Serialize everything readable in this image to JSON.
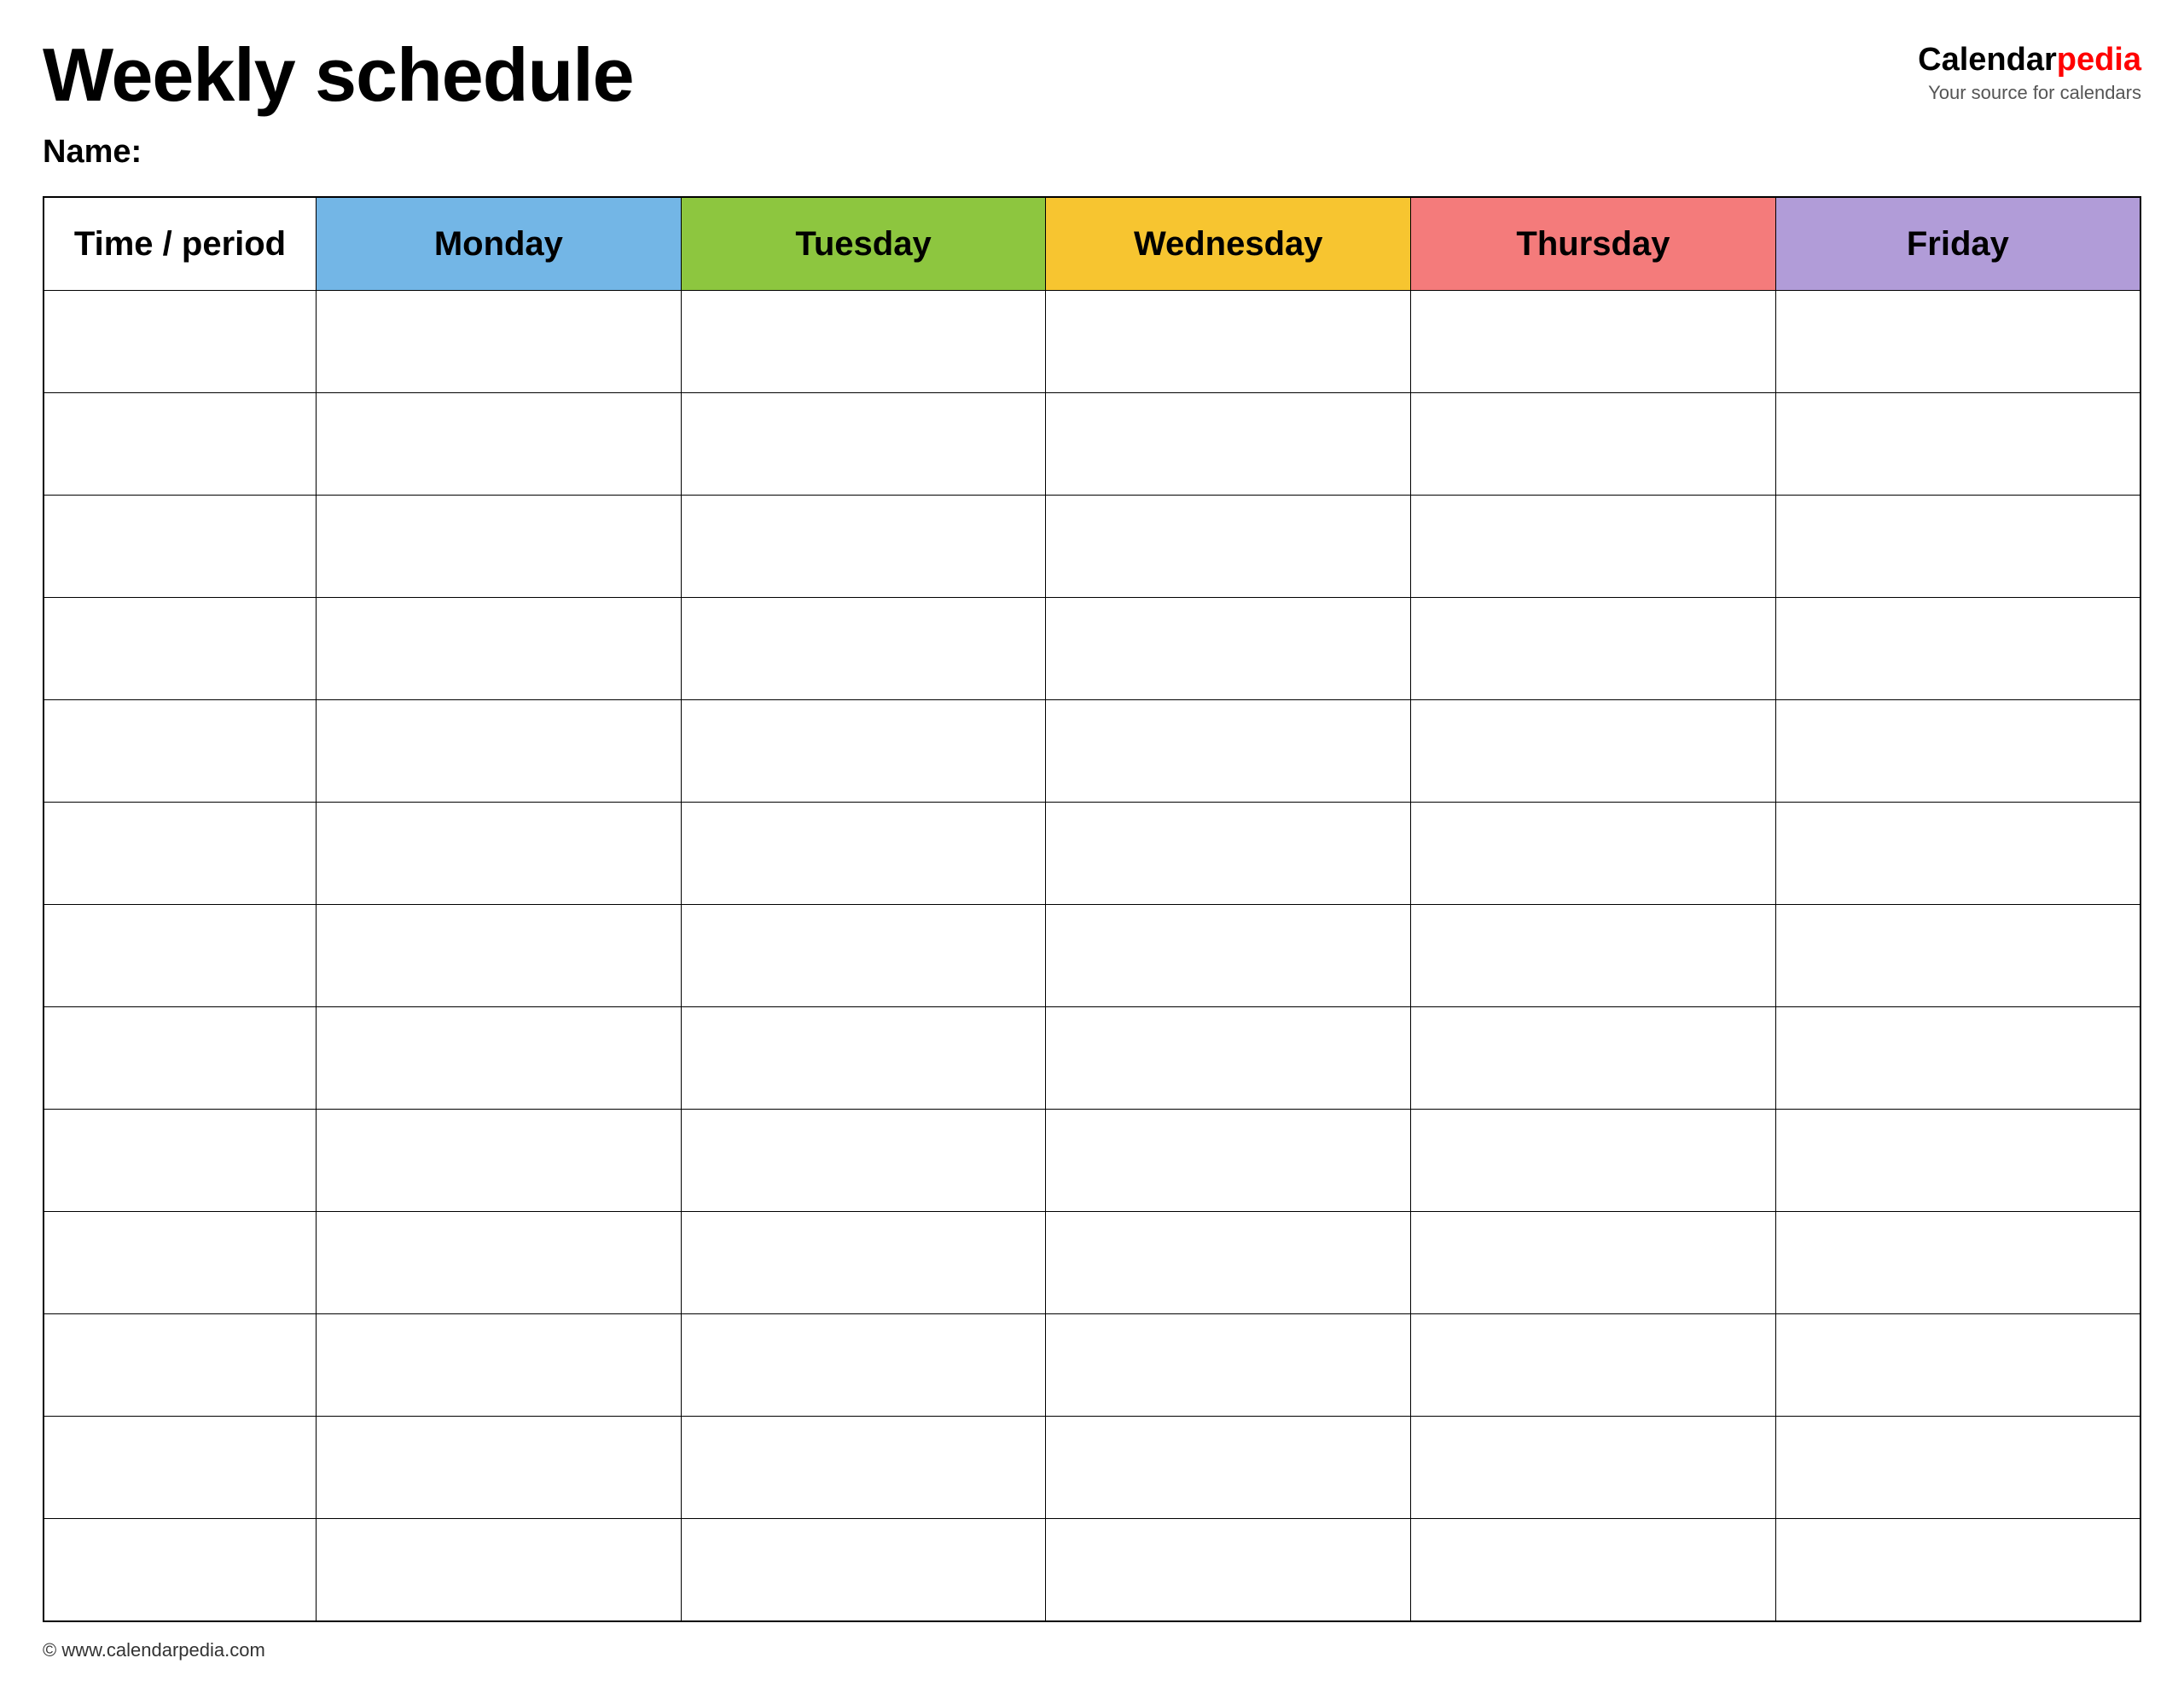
{
  "header": {
    "title": "Weekly schedule",
    "logo_calendar": "Calendar",
    "logo_pedia": "pedia",
    "logo_subtitle": "Your source for calendars",
    "name_label": "Name:"
  },
  "table": {
    "columns": [
      {
        "label": "Time / period",
        "key": "time",
        "color": "#ffffff",
        "text_color": "#000000"
      },
      {
        "label": "Monday",
        "key": "monday",
        "color": "#73b6e6",
        "text_color": "#000000"
      },
      {
        "label": "Tuesday",
        "key": "tuesday",
        "color": "#8dc63f",
        "text_color": "#000000"
      },
      {
        "label": "Wednesday",
        "key": "wednesday",
        "color": "#f7c530",
        "text_color": "#000000"
      },
      {
        "label": "Thursday",
        "key": "thursday",
        "color": "#f47b7b",
        "text_color": "#000000"
      },
      {
        "label": "Friday",
        "key": "friday",
        "color": "#b19cd8",
        "text_color": "#000000"
      }
    ],
    "row_count": 13
  },
  "footer": {
    "url": "© www.calendarpedia.com"
  }
}
